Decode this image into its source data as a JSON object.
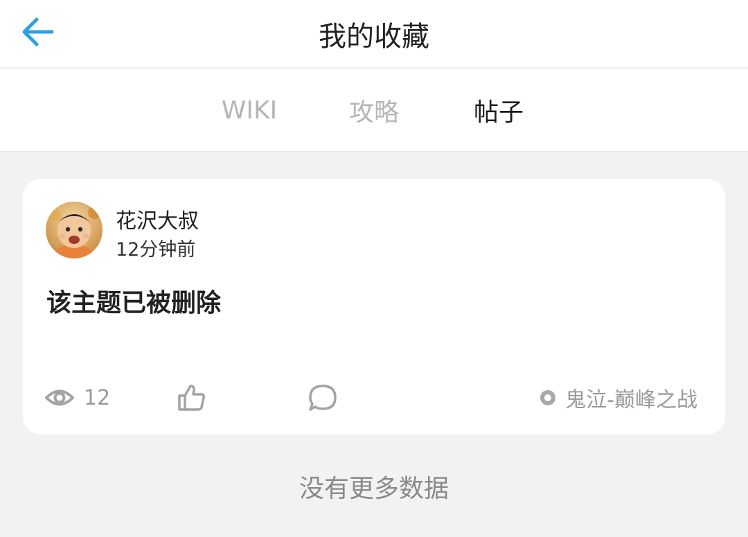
{
  "header": {
    "title": "我的收藏",
    "back_icon": "arrow-left-icon",
    "accent_color": "#2e9fe0"
  },
  "tabs": [
    {
      "label": "WIKI",
      "active": false
    },
    {
      "label": "攻略",
      "active": false
    },
    {
      "label": "帖子",
      "active": true
    }
  ],
  "post": {
    "author": "花沢大叔",
    "time": "12分钟前",
    "title": "该主题已被删除",
    "views": "12",
    "forum": "鬼泣-巅峰之战",
    "avatar_icon": "user-avatar-cartoon"
  },
  "list_footer": "没有更多数据"
}
